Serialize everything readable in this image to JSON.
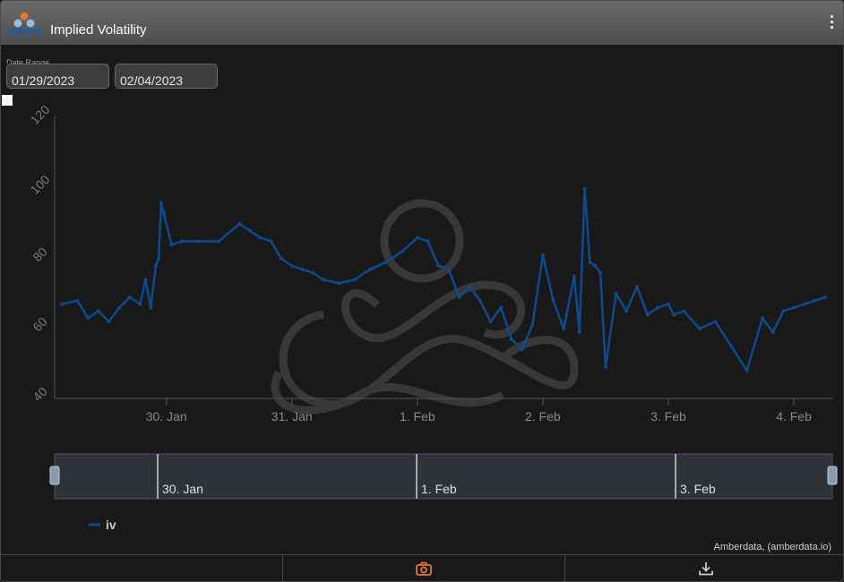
{
  "header": {
    "title": "Implied Volatility",
    "logo_icon": "amberdata-logo-icon",
    "menu_icon": "kebab-menu-icon"
  },
  "range": {
    "label": "Date Range",
    "start_date": "01/29/2023",
    "end_date": "02/04/2023"
  },
  "colors": {
    "series": "#0d4a8f",
    "accent": "#e8762b",
    "background": "#191919"
  },
  "credits": "Amberdata, (amberdata.io)",
  "footer": {
    "buttons": [
      "screenshot-button",
      "download-button"
    ],
    "icons": [
      "camera-icon",
      "download-icon"
    ]
  },
  "chart_data": {
    "type": "line",
    "title": "",
    "xlabel": "",
    "ylabel": "",
    "ylim": [
      40,
      120
    ],
    "yticks": [
      40,
      60,
      80,
      100,
      120
    ],
    "xticks": [
      "30. Jan",
      "31. Jan",
      "1. Feb",
      "2. Feb",
      "3. Feb",
      "4. Feb"
    ],
    "legend": "bottom-left",
    "grid": false,
    "navigator_ticks": [
      "30. Jan",
      "1. Feb",
      "3. Feb"
    ],
    "series": [
      {
        "name": "iv",
        "x": [
          "2023-01-29 04:00",
          "2023-01-29 07:00",
          "2023-01-29 09:00",
          "2023-01-29 11:00",
          "2023-01-29 13:00",
          "2023-01-29 15:00",
          "2023-01-29 17:00",
          "2023-01-29 19:00",
          "2023-01-29 20:00",
          "2023-01-29 21:00",
          "2023-01-29 22:00",
          "2023-01-29 22:30",
          "2023-01-29 23:00",
          "2023-01-29 23:30",
          "2023-01-30 01:00",
          "2023-01-30 03:00",
          "2023-01-30 06:00",
          "2023-01-30 10:00",
          "2023-01-30 14:00",
          "2023-01-30 16:00",
          "2023-01-30 18:00",
          "2023-01-30 20:00",
          "2023-01-30 22:00",
          "2023-01-31 00:00",
          "2023-01-31 02:00",
          "2023-01-31 04:00",
          "2023-01-31 06:00",
          "2023-01-31 09:00",
          "2023-01-31 12:00",
          "2023-01-31 15:00",
          "2023-01-31 18:00",
          "2023-01-31 21:00",
          "2023-02-01 00:00",
          "2023-02-01 02:00",
          "2023-02-01 04:00",
          "2023-02-01 06:00",
          "2023-02-01 08:00",
          "2023-02-01 10:00",
          "2023-02-01 12:00",
          "2023-02-01 14:00",
          "2023-02-01 16:00",
          "2023-02-01 18:00",
          "2023-02-01 20:00",
          "2023-02-01 22:00",
          "2023-02-02 00:00",
          "2023-02-02 02:00",
          "2023-02-02 04:00",
          "2023-02-02 06:00",
          "2023-02-02 07:00",
          "2023-02-02 08:00",
          "2023-02-02 09:00",
          "2023-02-02 10:00",
          "2023-02-02 11:00",
          "2023-02-02 12:00",
          "2023-02-02 14:00",
          "2023-02-02 16:00",
          "2023-02-02 18:00",
          "2023-02-02 20:00",
          "2023-02-02 22:00",
          "2023-02-03 00:00",
          "2023-02-03 01:00",
          "2023-02-03 03:00",
          "2023-02-03 06:00",
          "2023-02-03 09:00",
          "2023-02-03 12:00",
          "2023-02-03 15:00",
          "2023-02-03 18:00",
          "2023-02-03 20:00",
          "2023-02-03 22:00",
          "2023-02-04 00:00",
          "2023-02-04 02:00",
          "2023-02-04 04:00",
          "2023-02-04 06:00"
        ],
        "values": [
          67,
          68,
          63,
          65,
          62,
          66,
          69,
          67,
          74,
          66,
          78,
          80,
          96,
          93,
          84,
          85,
          85,
          85,
          90,
          88,
          86,
          85,
          80,
          78,
          77,
          76,
          74,
          73,
          74,
          77,
          79,
          82,
          86,
          85,
          78,
          77,
          69,
          72,
          68,
          62,
          66,
          57,
          54,
          61,
          81,
          68,
          60,
          75,
          59,
          100,
          79,
          78,
          76,
          49,
          70,
          65,
          72,
          64,
          66,
          67,
          64,
          65,
          60,
          62,
          55,
          48,
          63,
          59,
          65,
          66,
          67,
          68,
          69
        ]
      }
    ]
  }
}
